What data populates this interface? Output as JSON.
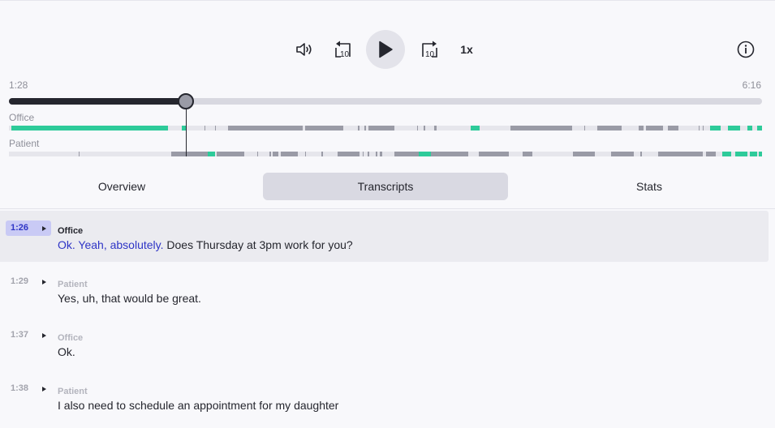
{
  "player": {
    "speed_label": "1x",
    "current_time": "1:28",
    "total_time": "6:16",
    "progress_fraction": 0.235,
    "icons": {
      "volume": "volume-icon",
      "rewind": "rewind-10-icon",
      "play": "play-icon",
      "forward": "forward-10-icon",
      "info": "info-icon"
    },
    "rewind_label": "10",
    "forward_label": "10"
  },
  "lanes": {
    "office_label": "Office",
    "patient_label": "Patient"
  },
  "tabs": [
    {
      "label": "Overview",
      "active": false
    },
    {
      "label": "Transcripts",
      "active": true
    },
    {
      "label": "Stats",
      "active": false
    }
  ],
  "transcript": [
    {
      "time": "1:26",
      "speaker": "Office",
      "text_highlight": "Ok. Yeah, absolutely.",
      "text_rest": " Does Thursday at 3pm work for you?",
      "active": true
    },
    {
      "time": "1:29",
      "speaker": "Patient",
      "text_highlight": "",
      "text_rest": "Yes, uh, that would be great.",
      "active": false
    },
    {
      "time": "1:37",
      "speaker": "Office",
      "text_highlight": "",
      "text_rest": "Ok.",
      "active": false
    },
    {
      "time": "1:38",
      "speaker": "Patient",
      "text_highlight": "",
      "text_rest": "I also need to schedule an appointment for my daughter",
      "active": false
    }
  ],
  "colors": {
    "accent": "#2f35c6",
    "speech_active": "#2ecb9a",
    "speech_inactive": "#9a9ba6",
    "track_fill": "#25262e"
  }
}
